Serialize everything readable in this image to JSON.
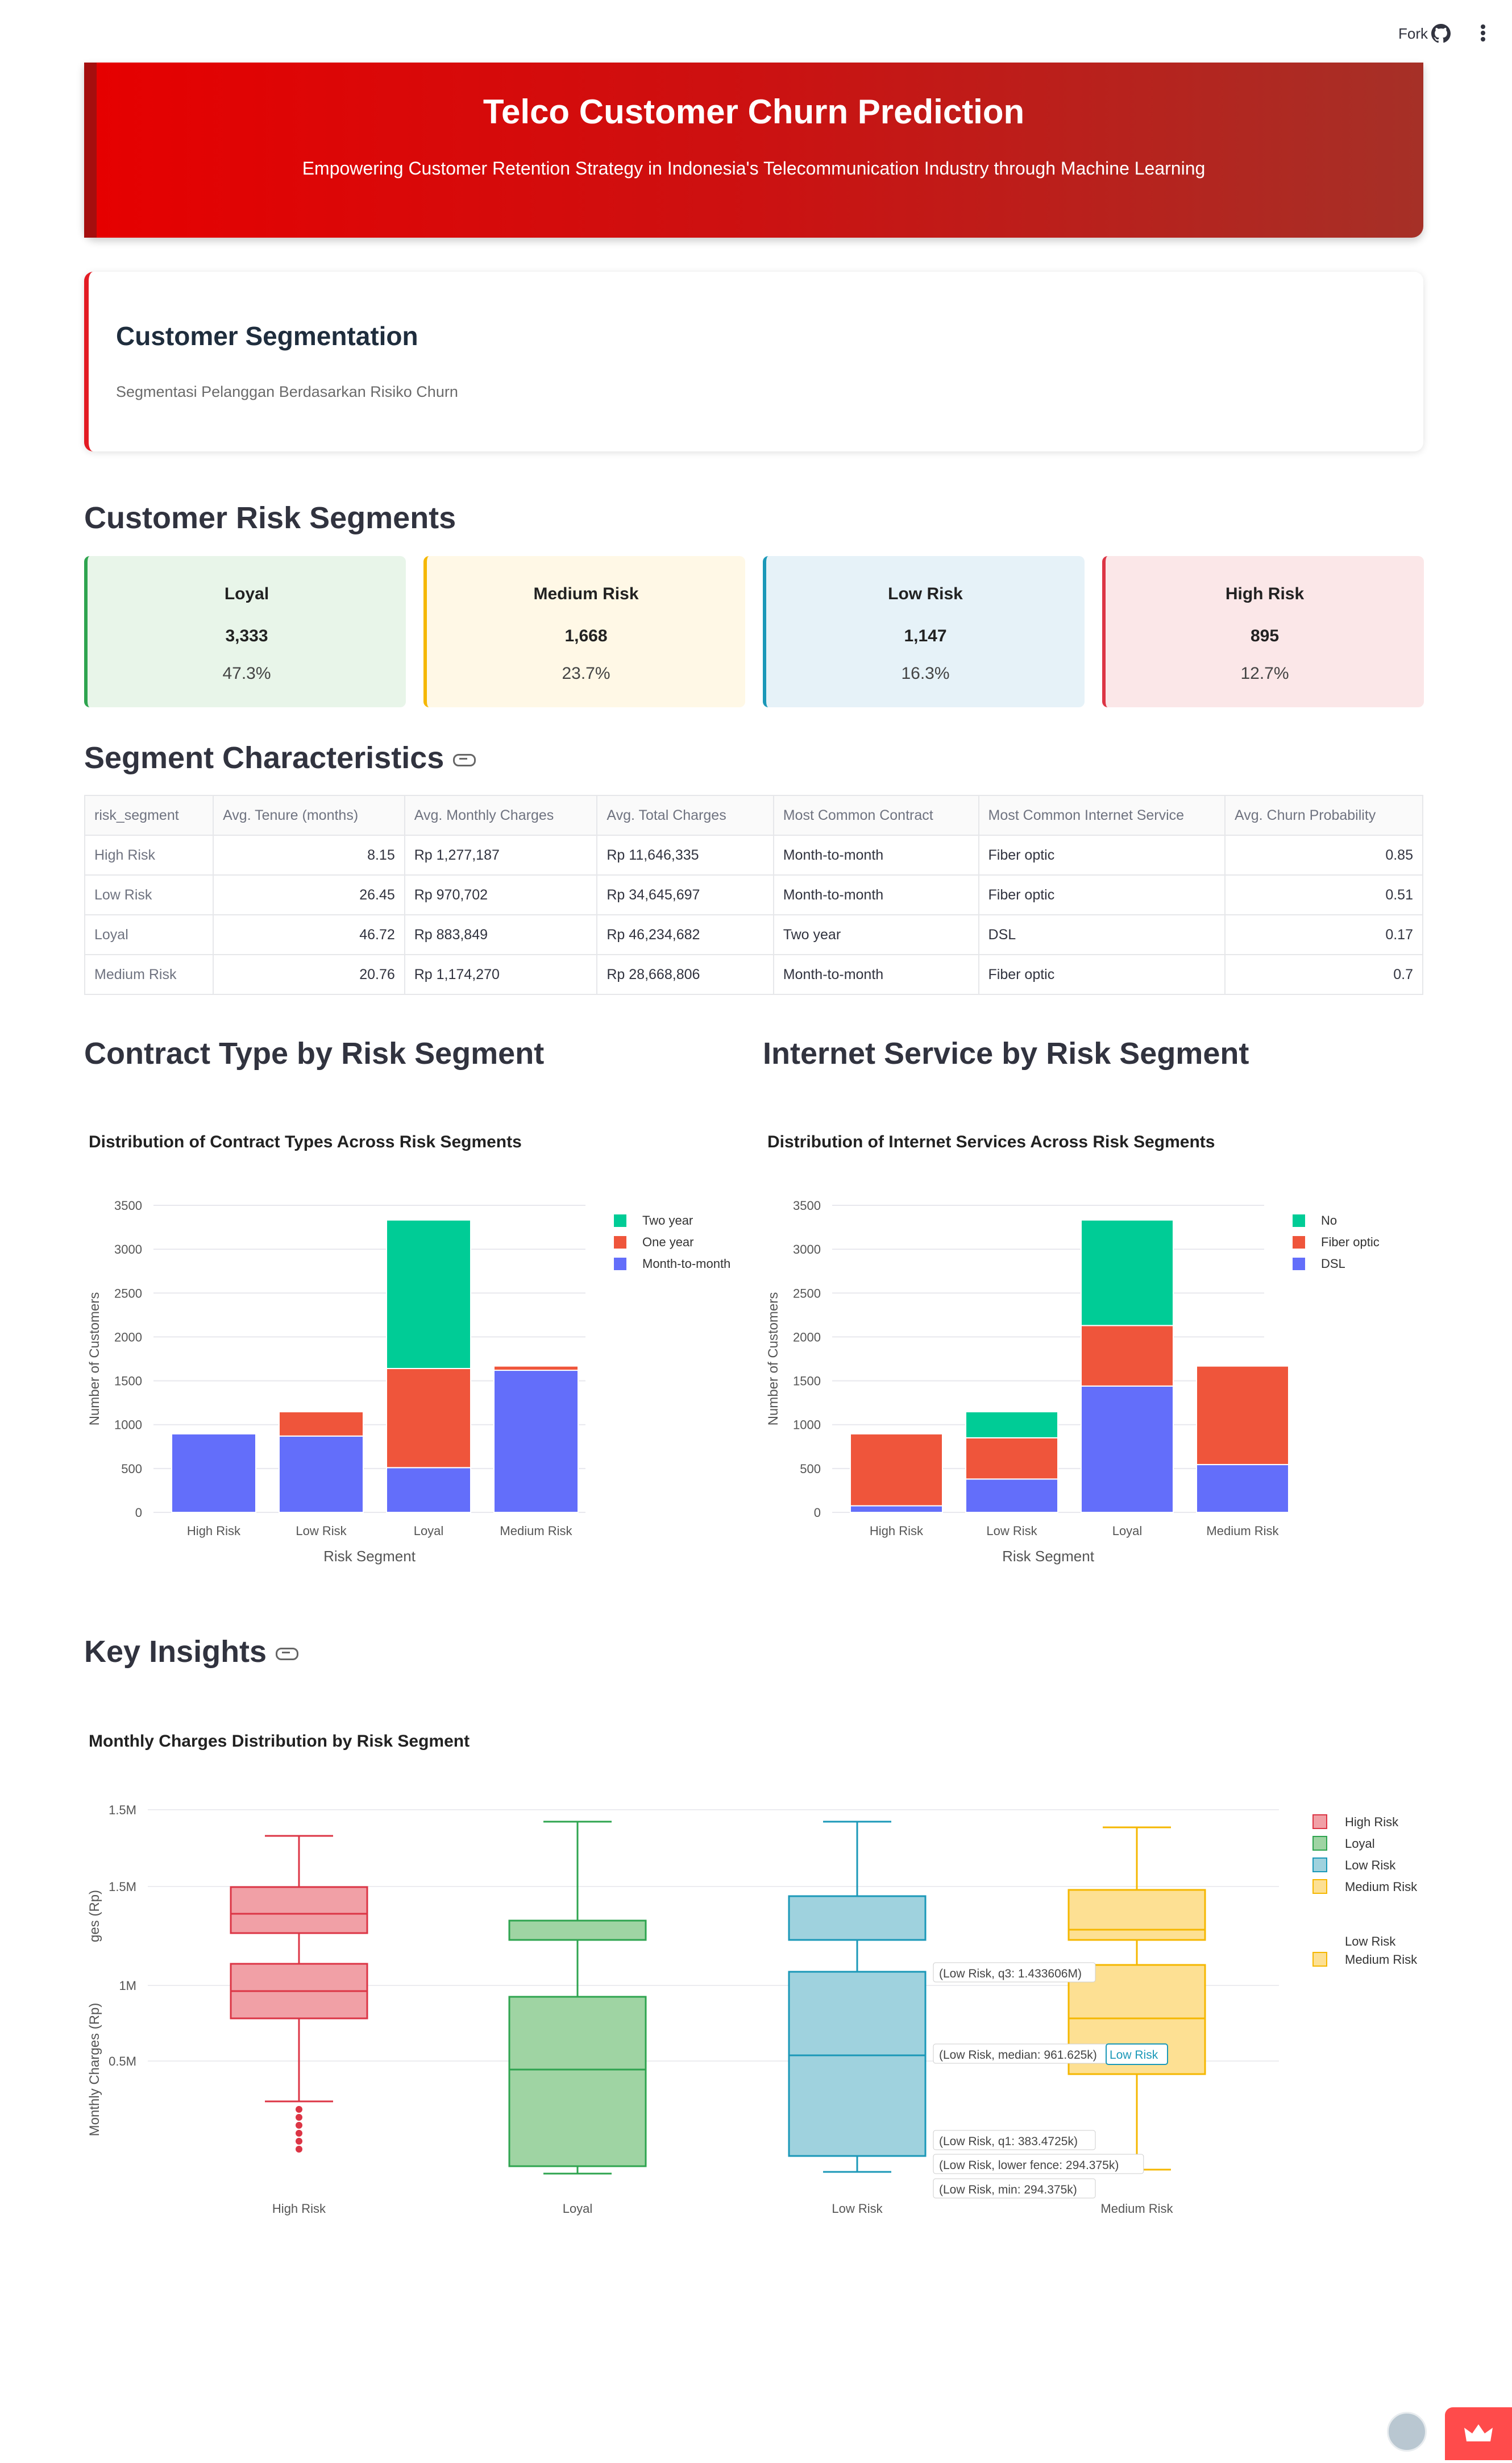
{
  "toolbar": {
    "fork_label": "Fork",
    "github_icon": "github-icon",
    "menu_icon": "more-vertical-icon"
  },
  "banner": {
    "title": "Telco Customer Churn Prediction",
    "subtitle": "Empowering Customer Retention Strategy in Indonesia's Telecommunication Industry through Machine Learning"
  },
  "segmentation": {
    "title": "Customer Segmentation",
    "subtitle": "Segmentasi Pelanggan Berdasarkan Risiko Churn"
  },
  "risk_segments": {
    "heading": "Customer Risk Segments",
    "cards": [
      {
        "label": "Loyal",
        "count": "3,333",
        "pct": "47.3%",
        "bg": "#e8f5e9",
        "border": "#2ea44f"
      },
      {
        "label": "Medium Risk",
        "count": "1,668",
        "pct": "23.7%",
        "bg": "#fff8e6",
        "border": "#f5b700"
      },
      {
        "label": "Low Risk",
        "count": "1,147",
        "pct": "16.3%",
        "bg": "#e6f2f8",
        "border": "#1b98b8"
      },
      {
        "label": "High Risk",
        "count": "895",
        "pct": "12.7%",
        "bg": "#fbe7e8",
        "border": "#dc3545"
      }
    ]
  },
  "characteristics": {
    "heading": "Segment Characteristics",
    "columns": [
      "risk_segment",
      "Avg. Tenure (months)",
      "Avg. Monthly Charges",
      "Avg. Total Charges",
      "Most Common Contract",
      "Most Common Internet Service",
      "Avg. Churn Probability"
    ],
    "rows": [
      [
        "High Risk",
        "8.15",
        "Rp 1,277,187",
        "Rp 11,646,335",
        "Month-to-month",
        "Fiber optic",
        "0.85"
      ],
      [
        "Low Risk",
        "26.45",
        "Rp 970,702",
        "Rp 34,645,697",
        "Month-to-month",
        "Fiber optic",
        "0.51"
      ],
      [
        "Loyal",
        "46.72",
        "Rp 883,849",
        "Rp 46,234,682",
        "Two year",
        "DSL",
        "0.17"
      ],
      [
        "Medium Risk",
        "20.76",
        "Rp 1,174,270",
        "Rp 28,668,806",
        "Month-to-month",
        "Fiber optic",
        "0.7"
      ]
    ]
  },
  "contract_section": {
    "heading": "Contract Type by Risk Segment"
  },
  "internet_section": {
    "heading": "Internet Service by Risk Segment"
  },
  "insights_section": {
    "heading": "Key Insights"
  },
  "chart_data": [
    {
      "type": "bar",
      "stacked": true,
      "title": "Distribution of Contract Types Across Risk Segments",
      "xlabel": "Risk Segment",
      "ylabel": "Number of Customers",
      "ylim": [
        0,
        3500
      ],
      "yticks": [
        0,
        500,
        1000,
        1500,
        2000,
        2500,
        3000,
        3500
      ],
      "categories": [
        "High Risk",
        "Low Risk",
        "Loyal",
        "Medium Risk"
      ],
      "legend_position": "top-right",
      "series": [
        {
          "name": "Month-to-month",
          "color": "#636efa",
          "values": [
            895,
            870,
            510,
            1620
          ]
        },
        {
          "name": "One year",
          "color": "#ef553b",
          "values": [
            0,
            277,
            1130,
            48
          ]
        },
        {
          "name": "Two year",
          "color": "#00cc96",
          "values": [
            0,
            0,
            1693,
            0
          ]
        }
      ],
      "legend_order": [
        "Two year",
        "One year",
        "Month-to-month"
      ]
    },
    {
      "type": "bar",
      "stacked": true,
      "title": "Distribution of Internet Services Across Risk Segments",
      "xlabel": "Risk Segment",
      "ylabel": "Number of Customers",
      "ylim": [
        0,
        3500
      ],
      "yticks": [
        0,
        500,
        1000,
        1500,
        2000,
        2500,
        3000,
        3500
      ],
      "categories": [
        "High Risk",
        "Low Risk",
        "Loyal",
        "Medium Risk"
      ],
      "legend_position": "top-right",
      "series": [
        {
          "name": "DSL",
          "color": "#636efa",
          "values": [
            75,
            380,
            1440,
            545
          ]
        },
        {
          "name": "Fiber optic",
          "color": "#ef553b",
          "values": [
            820,
            470,
            690,
            1123
          ]
        },
        {
          "name": "No",
          "color": "#00cc96",
          "values": [
            0,
            297,
            1203,
            0
          ]
        }
      ],
      "legend_order": [
        "No",
        "Fiber optic",
        "DSL"
      ]
    },
    {
      "type": "box",
      "title": "Monthly Charges Distribution by Risk Segment",
      "ylabel": "Monthly Charges (Rp)",
      "ytick_labels": [
        "0.5M",
        "1M",
        "1.5M",
        "1.5M"
      ],
      "categories": [
        "High Risk",
        "Loyal",
        "Low Risk",
        "Medium Risk"
      ],
      "series": [
        {
          "name": "High Risk",
          "color": "#dc3545",
          "fill": "#f1a0a6"
        },
        {
          "name": "Loyal",
          "color": "#2ea44f",
          "fill": "#9fd4a3"
        },
        {
          "name": "Low Risk",
          "color": "#1b98b8",
          "fill": "#9fd2de"
        },
        {
          "name": "Medium Risk",
          "color": "#f5b700",
          "fill": "#fde093"
        }
      ],
      "legend_extra": [
        "Low Risk",
        "Medium Risk"
      ],
      "hover_label": "Low Risk",
      "hover": [
        "(Low Risk, q3: 1.433606M)",
        "(Low Risk, median: 961.625k)",
        "(Low Risk, q1: 383.4725k)",
        "(Low Risk, lower fence: 294.375k)",
        "(Low Risk, min: 294.375k)"
      ],
      "hover_overlap_label": "ges (Rp)"
    }
  ]
}
